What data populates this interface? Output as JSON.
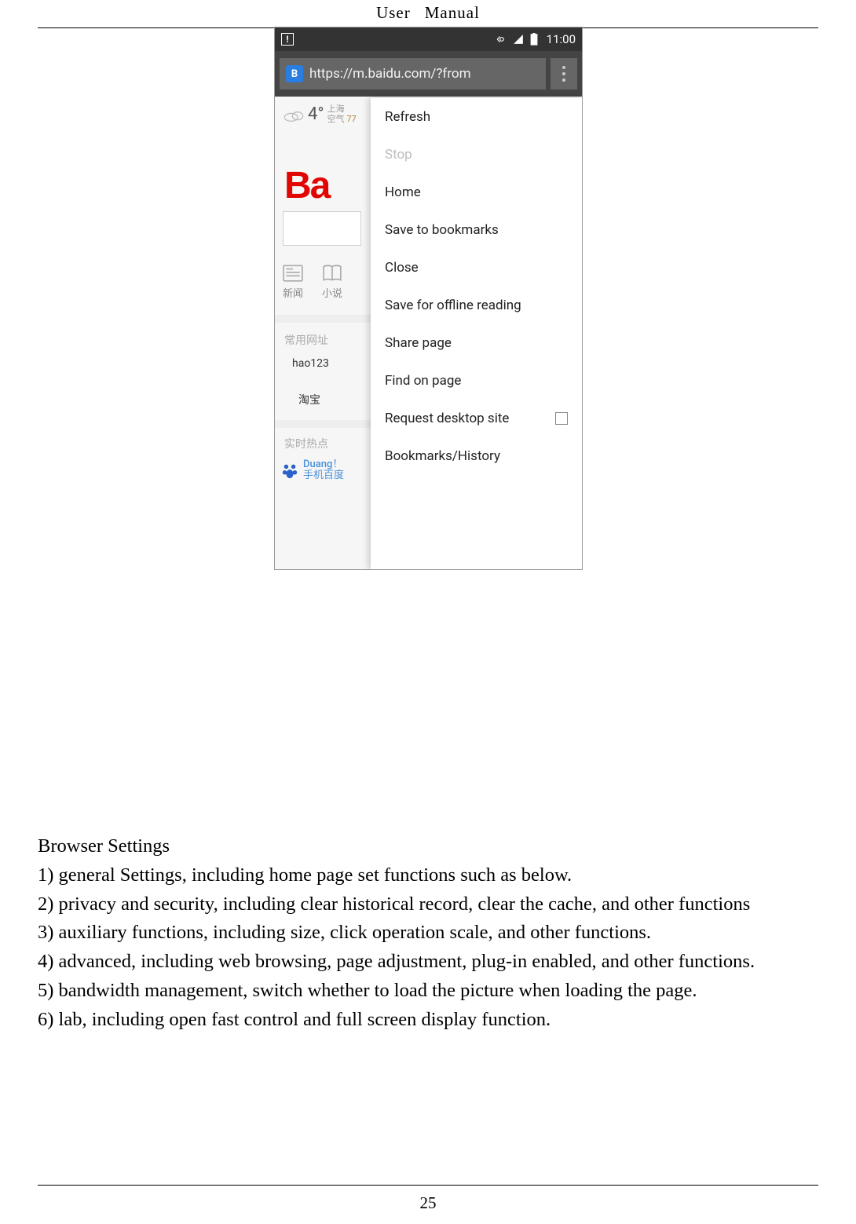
{
  "header": {
    "left": "User",
    "right": "Manual"
  },
  "footer": {
    "page_number": "25"
  },
  "phone": {
    "status": {
      "time": "11:00"
    },
    "url": "https://m.baidu.com/?from",
    "weather": {
      "temp": "4°",
      "city": "上海",
      "aqi_label": "空气",
      "aqi_value": "77"
    },
    "logo_fragment": "Ba",
    "nav": {
      "news_icon_label": "新闻",
      "novel_icon_label": "小说"
    },
    "sections": {
      "common_sites": "常用网址",
      "hot": "实时热点"
    },
    "links": {
      "hao123": "hao123",
      "taobao": "淘宝"
    },
    "paw": {
      "line1": "Duang！",
      "line2": "手机百度",
      "alt": "手机百度"
    },
    "menu": {
      "refresh": "Refresh",
      "stop": "Stop",
      "home": "Home",
      "save_bookmark": "Save to bookmarks",
      "close": "Close",
      "save_offline": "Save for offline reading",
      "share": "Share page",
      "find": "Find on page",
      "request_desktop": "Request desktop site",
      "bookmarks_history": "Bookmarks/History"
    }
  },
  "body": {
    "heading": "Browser Settings",
    "l1": "1) general Settings, including home page set functions such as below.",
    "l2": "2) privacy and security, including clear historical record, clear the cache, and other functions",
    "l3": "3) auxiliary functions, including size, click operation scale, and other functions.",
    "l4": "4) advanced, including web browsing, page adjustment, plug-in enabled, and other functions.",
    "l5": "5) bandwidth management, switch whether to load the picture when loading the page.",
    "l6": "6) lab, including open fast control and full screen display function."
  }
}
